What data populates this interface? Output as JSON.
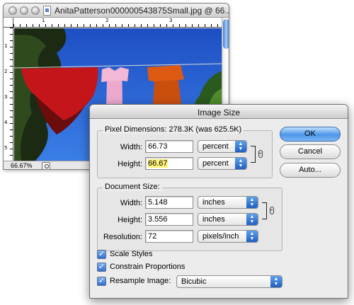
{
  "document_window": {
    "title": "AnitaPatterson000000543875Small.jpg @ 66...",
    "zoom": "66.67%",
    "ruler_top_numbers": [
      "1",
      "2",
      "3"
    ],
    "ruler_left_numbers": [
      "1",
      "2",
      "3",
      "4",
      "5"
    ]
  },
  "dialog": {
    "title": "Image Size",
    "pixel_dimensions": {
      "label": "Pixel Dimensions:",
      "size": "278.3K (was 625.5K)",
      "width_label": "Width:",
      "width_value": "66.73",
      "width_unit": "percent",
      "height_label": "Height:",
      "height_value": "66.67",
      "height_unit": "percent"
    },
    "document_size": {
      "label": "Document Size:",
      "width_label": "Width:",
      "width_value": "5.148",
      "width_unit": "inches",
      "height_label": "Height:",
      "height_value": "3.556",
      "height_unit": "inches",
      "resolution_label": "Resolution:",
      "resolution_value": "72",
      "resolution_unit": "pixels/inch"
    },
    "buttons": {
      "ok": "OK",
      "cancel": "Cancel",
      "auto": "Auto..."
    },
    "options": {
      "scale_styles": "Scale Styles",
      "constrain_proportions": "Constrain Proportions",
      "resample_image": "Resample Image:",
      "resample_method": "Bicubic"
    }
  }
}
